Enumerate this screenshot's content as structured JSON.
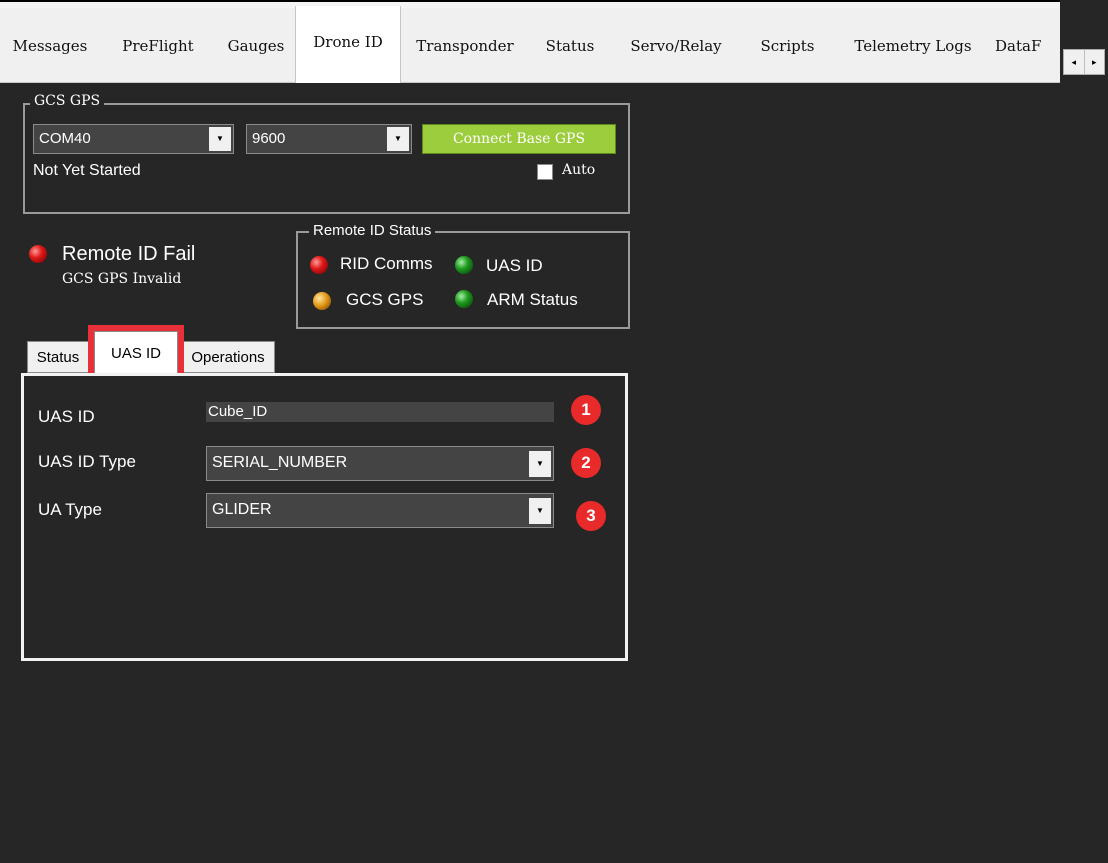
{
  "tabs": [
    "Messages",
    "PreFlight",
    "Gauges",
    "Drone ID",
    "Transponder",
    "Status",
    "Servo/Relay",
    "Scripts",
    "Telemetry Logs",
    "DataF"
  ],
  "active_tab": "Drone ID",
  "tab_scroll": {
    "left": "◂",
    "right": "▸"
  },
  "gcs_gps": {
    "title": "GCS GPS",
    "port": "COM40",
    "baud": "9600",
    "connect_label": "Connect Base GPS",
    "status": "Not Yet Started",
    "auto_label": "Auto"
  },
  "remote_id": {
    "status_title": "Remote ID Fail",
    "status_detail": "GCS GPS Invalid",
    "status_led": "red"
  },
  "remote_id_status": {
    "title": "Remote ID Status",
    "items": [
      {
        "label": "RID Comms",
        "led": "red"
      },
      {
        "label": "UAS ID",
        "led": "green"
      },
      {
        "label": "GCS GPS",
        "led": "orange"
      },
      {
        "label": "ARM Status",
        "led": "green"
      }
    ]
  },
  "sub_tabs": [
    "Status",
    "UAS ID",
    "Operations"
  ],
  "active_sub_tab": "UAS ID",
  "form": {
    "uas_id_label": "UAS ID",
    "uas_id_value": "Cube_ID",
    "uas_id_type_label": "UAS ID Type",
    "uas_id_type_value": "SERIAL_NUMBER",
    "ua_type_label": "UA Type",
    "ua_type_value": "GLIDER"
  },
  "badges": [
    "1",
    "2",
    "3"
  ],
  "colors": {
    "background": "#262626",
    "connect_button": "#9ccd3c",
    "highlight": "#e8303a",
    "badge": "#e82a2a"
  }
}
